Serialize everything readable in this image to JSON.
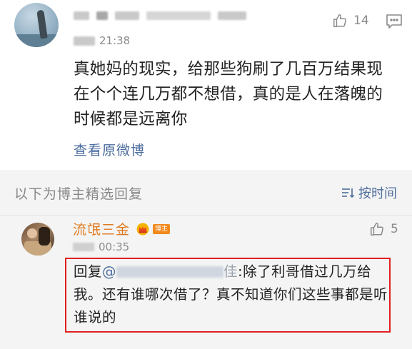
{
  "top_comment": {
    "time": "21:38",
    "like_count": "14",
    "text": "真她妈的现实，给那些狗刷了几百万结果现在个个连几万都不想借，真的是人在落魄的时候都是远离你",
    "view_original_label": "查看原微博"
  },
  "section": {
    "title": "以下为博主精选回复",
    "sort_label": "按时间"
  },
  "reply": {
    "author": "流氓三金",
    "badge": "博主",
    "time": "00:35",
    "like_count": "5",
    "prefix": "回复",
    "mention_at": "@",
    "mention_tail": "佳",
    "body": ":除了利哥借过几万给我。还有谁哪次借了？真不知道你们这些事都是听谁说的"
  },
  "colors": {
    "link": "#4a6b9d",
    "author": "#e07a1f",
    "highlight_border": "#e02020",
    "section_bg": "#f4f4f4"
  },
  "icons": {
    "like": "thumbs-up-icon",
    "comment": "comment-icon",
    "sort": "sort-icon",
    "crown": "crown-icon"
  }
}
